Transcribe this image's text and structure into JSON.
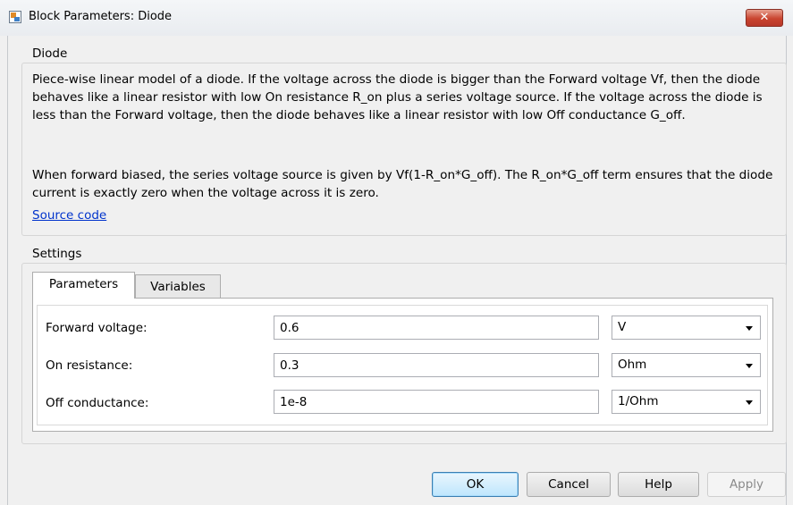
{
  "window": {
    "title": "Block Parameters: Diode",
    "close_glyph": "✕"
  },
  "block_section": {
    "label": "Diode",
    "description_1": "Piece-wise linear model of a diode. If the voltage across the diode is bigger than the Forward voltage Vf, then the diode behaves like a linear resistor with low On resistance R_on plus a series voltage source. If the voltage across the diode is less than the Forward voltage, then the diode behaves like a linear resistor with low Off conductance G_off.",
    "description_2": "When forward biased, the series voltage source is given by Vf(1-R_on*G_off). The R_on*G_off term ensures that the diode current is exactly zero when the voltage across it is zero.",
    "source_link": "Source code"
  },
  "settings": {
    "label": "Settings",
    "tabs": [
      {
        "label": "Parameters",
        "active": true
      },
      {
        "label": "Variables",
        "active": false
      }
    ],
    "parameters": [
      {
        "label": "Forward voltage:",
        "value": "0.6",
        "unit": "V"
      },
      {
        "label": "On resistance:",
        "value": "0.3",
        "unit": "Ohm"
      },
      {
        "label": "Off conductance:",
        "value": "1e-8",
        "unit": "1/Ohm"
      }
    ]
  },
  "buttons": {
    "ok": "OK",
    "cancel": "Cancel",
    "help": "Help",
    "apply": "Apply"
  },
  "colors": {
    "link": "#0033cc",
    "close_button": "#c9442f",
    "default_button": "#3c7fb1"
  },
  "icons": {
    "app": "block-parameters-icon",
    "close": "close-icon",
    "dropdown": "chevron-down-icon"
  }
}
